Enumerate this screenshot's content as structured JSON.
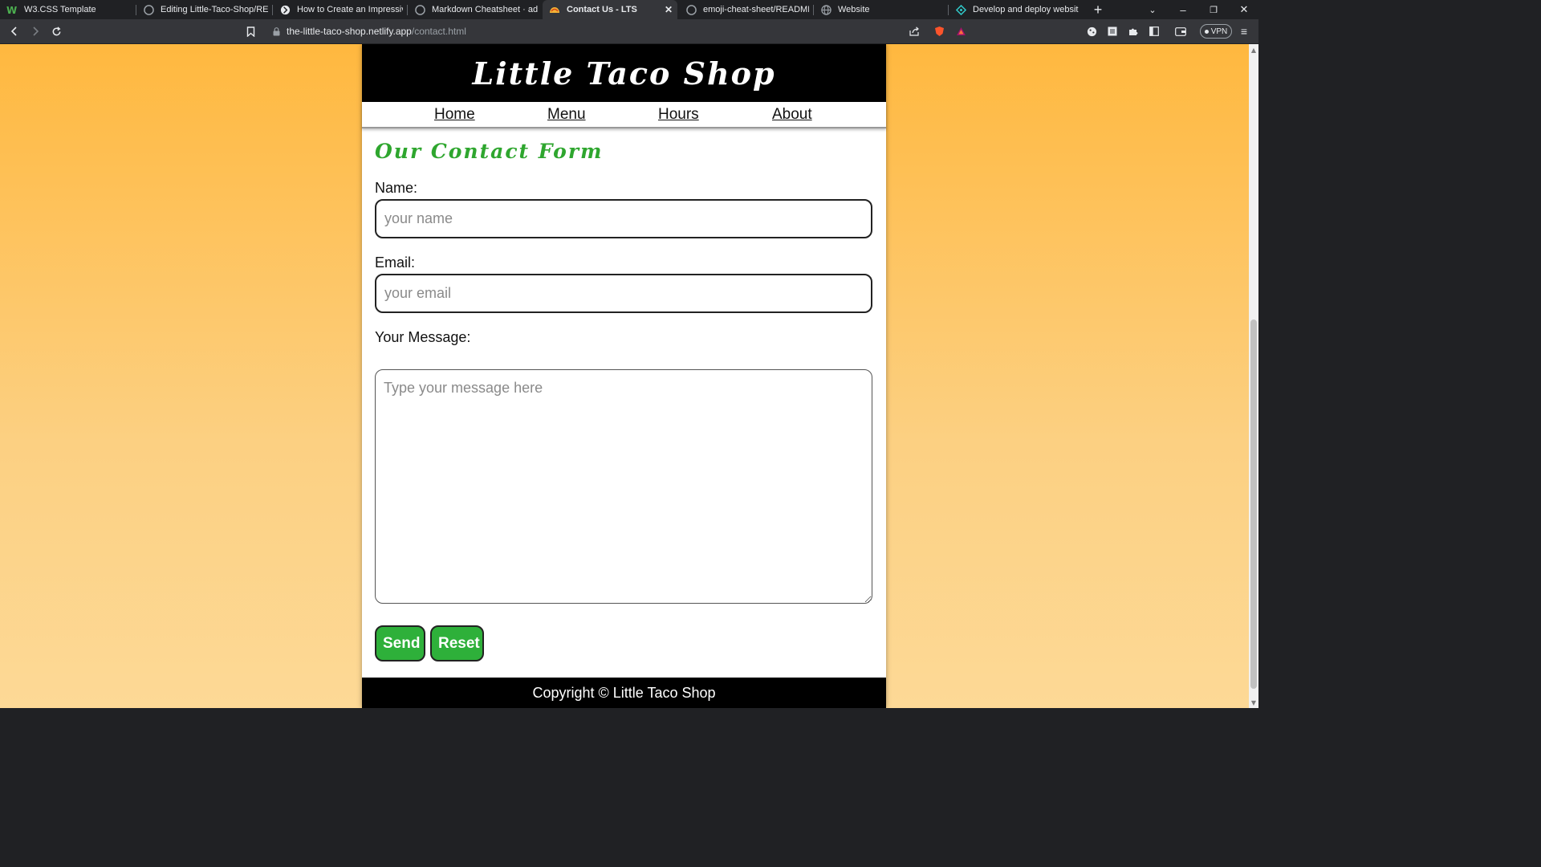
{
  "browser": {
    "tabs": [
      {
        "title": "W3.CSS Template",
        "icon": "w3-logo-icon"
      },
      {
        "title": "Editing Little-Taco-Shop/README",
        "icon": "github-icon"
      },
      {
        "title": "How to Create an Impressive Gi",
        "icon": "blog-icon"
      },
      {
        "title": "Markdown Cheatsheet · adam-p",
        "icon": "github-icon"
      },
      {
        "title": "Contact Us - LTS",
        "icon": "taco-icon",
        "active": true
      },
      {
        "title": "emoji-cheat-sheet/README.md",
        "icon": "github-icon"
      },
      {
        "title": "Website",
        "icon": "globe-icon"
      },
      {
        "title": "Develop and deploy websites a",
        "icon": "netlify-icon"
      }
    ],
    "url_host": "the-little-taco-shop.netlify.app",
    "url_path": "/contact.html",
    "vpn_label": "VPN"
  },
  "site": {
    "title": "Little Taco Shop",
    "nav": [
      "Home",
      "Menu",
      "Hours",
      "About"
    ],
    "footer": "Copyright © Little Taco Shop"
  },
  "form": {
    "heading": "Our Contact Form",
    "name_label": "Name:",
    "name_placeholder": "your name",
    "email_label": "Email:",
    "email_placeholder": "your email",
    "message_label": "Your Message:",
    "message_placeholder": "Type your message here",
    "send_label": "Send",
    "reset_label": "Reset"
  },
  "colors": {
    "accent_green": "#2eb03a",
    "background_top": "#ffb83f",
    "background_bottom": "#fdd996",
    "banner": "#000000"
  }
}
